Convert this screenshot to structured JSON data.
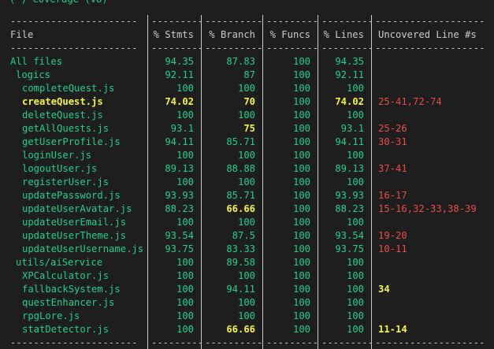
{
  "terminal": {
    "cut_text": "(-) coverage (v8)"
  },
  "columns": [
    {
      "label": "File"
    },
    {
      "label": "% Stmts"
    },
    {
      "label": "% Branch"
    },
    {
      "label": "% Funcs"
    },
    {
      "label": "% Lines"
    },
    {
      "label": "Uncovered Line #s"
    }
  ],
  "rows": [
    {
      "file": "All files",
      "level": 0,
      "stmts": "94.35",
      "branch": "87.83",
      "funcs": "100",
      "lines": "94.35",
      "uncovered": "",
      "file_color": "green",
      "stmts_color": "green",
      "branch_color": "green",
      "funcs_color": "green",
      "lines_color": "green",
      "uncovered_color": ""
    },
    {
      "file": "logics",
      "level": 1,
      "stmts": "92.11",
      "branch": "87",
      "funcs": "100",
      "lines": "92.11",
      "uncovered": "",
      "file_color": "green",
      "stmts_color": "green",
      "branch_color": "green",
      "funcs_color": "green",
      "lines_color": "green",
      "uncovered_color": ""
    },
    {
      "file": "completeQuest.js",
      "level": 2,
      "stmts": "100",
      "branch": "100",
      "funcs": "100",
      "lines": "100",
      "uncovered": "",
      "file_color": "green",
      "stmts_color": "green",
      "branch_color": "green",
      "funcs_color": "green",
      "lines_color": "green",
      "uncovered_color": ""
    },
    {
      "file": "createQuest.js",
      "level": 2,
      "stmts": "74.02",
      "branch": "70",
      "funcs": "100",
      "lines": "74.02",
      "uncovered": "25-41,72-74",
      "file_color": "yellow",
      "stmts_color": "yellow",
      "branch_color": "yellow",
      "funcs_color": "green",
      "lines_color": "yellow",
      "uncovered_color": "red"
    },
    {
      "file": "deleteQuest.js",
      "level": 2,
      "stmts": "100",
      "branch": "100",
      "funcs": "100",
      "lines": "100",
      "uncovered": "",
      "file_color": "green",
      "stmts_color": "green",
      "branch_color": "green",
      "funcs_color": "green",
      "lines_color": "green",
      "uncovered_color": ""
    },
    {
      "file": "getAllQuests.js",
      "level": 2,
      "stmts": "93.1",
      "branch": "75",
      "funcs": "100",
      "lines": "93.1",
      "uncovered": "25-26",
      "file_color": "green",
      "stmts_color": "green",
      "branch_color": "yellow",
      "funcs_color": "green",
      "lines_color": "green",
      "uncovered_color": "red"
    },
    {
      "file": "getUserProfile.js",
      "level": 2,
      "stmts": "94.11",
      "branch": "85.71",
      "funcs": "100",
      "lines": "94.11",
      "uncovered": "30-31",
      "file_color": "green",
      "stmts_color": "green",
      "branch_color": "green",
      "funcs_color": "green",
      "lines_color": "green",
      "uncovered_color": "red"
    },
    {
      "file": "loginUser.js",
      "level": 2,
      "stmts": "100",
      "branch": "100",
      "funcs": "100",
      "lines": "100",
      "uncovered": "",
      "file_color": "green",
      "stmts_color": "green",
      "branch_color": "green",
      "funcs_color": "green",
      "lines_color": "green",
      "uncovered_color": ""
    },
    {
      "file": "logoutUser.js",
      "level": 2,
      "stmts": "89.13",
      "branch": "88.88",
      "funcs": "100",
      "lines": "89.13",
      "uncovered": "37-41",
      "file_color": "green",
      "stmts_color": "green",
      "branch_color": "green",
      "funcs_color": "green",
      "lines_color": "green",
      "uncovered_color": "red"
    },
    {
      "file": "registerUser.js",
      "level": 2,
      "stmts": "100",
      "branch": "100",
      "funcs": "100",
      "lines": "100",
      "uncovered": "",
      "file_color": "green",
      "stmts_color": "green",
      "branch_color": "green",
      "funcs_color": "green",
      "lines_color": "green",
      "uncovered_color": ""
    },
    {
      "file": "updatePassword.js",
      "level": 2,
      "stmts": "93.93",
      "branch": "85.71",
      "funcs": "100",
      "lines": "93.93",
      "uncovered": "16-17",
      "file_color": "green",
      "stmts_color": "green",
      "branch_color": "green",
      "funcs_color": "green",
      "lines_color": "green",
      "uncovered_color": "red"
    },
    {
      "file": "updateUserAvatar.js",
      "level": 2,
      "stmts": "88.23",
      "branch": "66.66",
      "funcs": "100",
      "lines": "88.23",
      "uncovered": "15-16,32-33,38-39",
      "file_color": "green",
      "stmts_color": "green",
      "branch_color": "yellow",
      "funcs_color": "green",
      "lines_color": "green",
      "uncovered_color": "red"
    },
    {
      "file": "updateUserEmail.js",
      "level": 2,
      "stmts": "100",
      "branch": "100",
      "funcs": "100",
      "lines": "100",
      "uncovered": "",
      "file_color": "green",
      "stmts_color": "green",
      "branch_color": "green",
      "funcs_color": "green",
      "lines_color": "green",
      "uncovered_color": ""
    },
    {
      "file": "updateUserTheme.js",
      "level": 2,
      "stmts": "93.54",
      "branch": "87.5",
      "funcs": "100",
      "lines": "93.54",
      "uncovered": "19-20",
      "file_color": "green",
      "stmts_color": "green",
      "branch_color": "green",
      "funcs_color": "green",
      "lines_color": "green",
      "uncovered_color": "red"
    },
    {
      "file": "updateUserUsername.js",
      "level": 2,
      "stmts": "93.75",
      "branch": "83.33",
      "funcs": "100",
      "lines": "93.75",
      "uncovered": "10-11",
      "file_color": "green",
      "stmts_color": "green",
      "branch_color": "green",
      "funcs_color": "green",
      "lines_color": "green",
      "uncovered_color": "red"
    },
    {
      "file": "utils/aiService",
      "level": 1,
      "stmts": "100",
      "branch": "89.58",
      "funcs": "100",
      "lines": "100",
      "uncovered": "",
      "file_color": "green",
      "stmts_color": "green",
      "branch_color": "green",
      "funcs_color": "green",
      "lines_color": "green",
      "uncovered_color": ""
    },
    {
      "file": "XPCalculator.js",
      "level": 2,
      "stmts": "100",
      "branch": "100",
      "funcs": "100",
      "lines": "100",
      "uncovered": "",
      "file_color": "green",
      "stmts_color": "green",
      "branch_color": "green",
      "funcs_color": "green",
      "lines_color": "green",
      "uncovered_color": ""
    },
    {
      "file": "fallbackSystem.js",
      "level": 2,
      "stmts": "100",
      "branch": "94.11",
      "funcs": "100",
      "lines": "100",
      "uncovered": "34",
      "file_color": "green",
      "stmts_color": "green",
      "branch_color": "green",
      "funcs_color": "green",
      "lines_color": "green",
      "uncovered_color": "yellow"
    },
    {
      "file": "questEnhancer.js",
      "level": 2,
      "stmts": "100",
      "branch": "100",
      "funcs": "100",
      "lines": "100",
      "uncovered": "",
      "file_color": "green",
      "stmts_color": "green",
      "branch_color": "green",
      "funcs_color": "green",
      "lines_color": "green",
      "uncovered_color": ""
    },
    {
      "file": "rpgLore.js",
      "level": 2,
      "stmts": "100",
      "branch": "100",
      "funcs": "100",
      "lines": "100",
      "uncovered": "",
      "file_color": "green",
      "stmts_color": "green",
      "branch_color": "green",
      "funcs_color": "green",
      "lines_color": "green",
      "uncovered_color": ""
    },
    {
      "file": "statDetector.js",
      "level": 2,
      "stmts": "100",
      "branch": "66.66",
      "funcs": "100",
      "lines": "100",
      "uncovered": "11-14",
      "file_color": "green",
      "stmts_color": "green",
      "branch_color": "yellow",
      "funcs_color": "green",
      "lines_color": "green",
      "uncovered_color": "yellow"
    }
  ],
  "colors": {
    "background": "#1e1e1e",
    "text": "#cccccc",
    "green": "#23d18b",
    "yellow": "#f5f543",
    "red": "#f14c4c"
  }
}
